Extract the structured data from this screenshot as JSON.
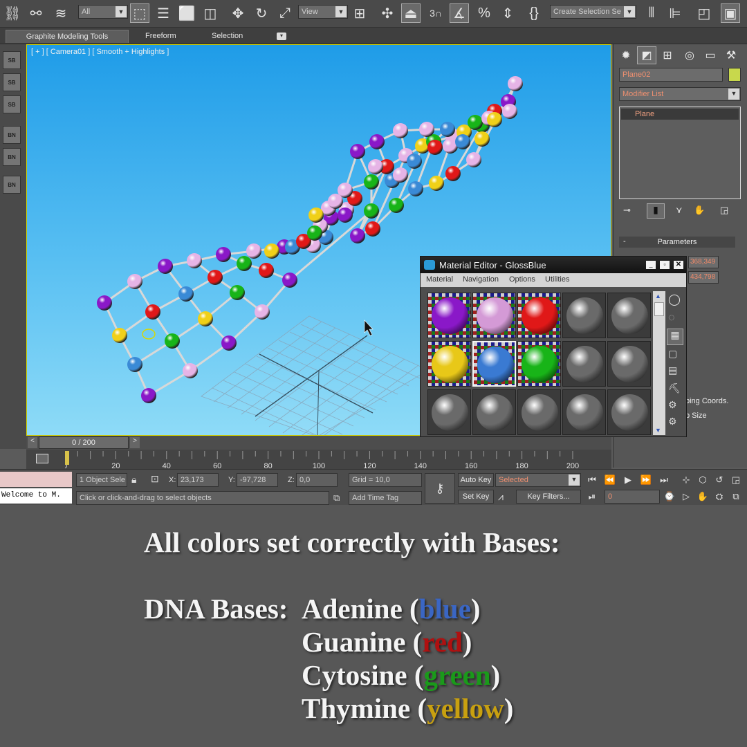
{
  "toolbar": {
    "selection_filter": "All",
    "ref_coord": "View",
    "snap_label": "3",
    "selection_set_placeholder": "Create Selection Se",
    "icons": [
      "link-icon",
      "unlink-icon",
      "bind-space-warp-icon",
      "select-object-icon",
      "select-by-name-icon",
      "rect-region-icon",
      "window-crossing-icon",
      "move-icon",
      "rotate-icon",
      "scale-icon",
      "pivot-icon",
      "mirror-icon",
      "align-icon",
      "layer-icon",
      "render-setup-icon"
    ]
  },
  "ribbon": {
    "tabs": [
      "Graphite Modeling Tools",
      "Freeform",
      "Selection"
    ]
  },
  "viewport": {
    "label": "[ + ] [ Camera01 ] [ Smooth + Highlights ]"
  },
  "timeline": {
    "frame": "0 / 200",
    "ticks": [
      "0",
      "20",
      "40",
      "60",
      "80",
      "100",
      "120",
      "140",
      "160",
      "180",
      "200"
    ]
  },
  "command_panel": {
    "object_name": "Plane02",
    "modifier_list": "Modifier List",
    "stack_item": "Plane",
    "rollout": "Parameters",
    "length_value": "368,349",
    "width_value": "434,798",
    "mapping_label": "ping Coords.",
    "map_size_label": "p Size",
    "object_color": "#c8d84c"
  },
  "material_editor": {
    "title": "Material Editor - GlossBlue",
    "menu": [
      "Material",
      "Navigation",
      "Options",
      "Utilities"
    ],
    "slots": [
      {
        "color": "#8a18c8",
        "active": true
      },
      {
        "color": "#d49ad6",
        "active": true
      },
      {
        "color": "#e01818",
        "active": true
      },
      {
        "color": "#6a6a6a",
        "active": false
      },
      {
        "color": "#6a6a6a",
        "active": false
      },
      {
        "color": "#e8c818",
        "active": true
      },
      {
        "color": "#3a7ad2",
        "active": true
      },
      {
        "color": "#18b418",
        "active": true
      },
      {
        "color": "#6a6a6a",
        "active": false
      },
      {
        "color": "#6a6a6a",
        "active": false
      },
      {
        "color": "#6a6a6a",
        "active": false
      },
      {
        "color": "#6a6a6a",
        "active": false
      },
      {
        "color": "#6a6a6a",
        "active": false
      },
      {
        "color": "#6a6a6a",
        "active": false
      },
      {
        "color": "#6a6a6a",
        "active": false
      }
    ]
  },
  "status": {
    "listener": "Welcome to M.",
    "selection_info": "1 Object Sele",
    "x_label": "X:",
    "x_value": "23,173",
    "y_label": "Y:",
    "y_value": "-97,728",
    "z_label": "Z:",
    "z_value": "0,0",
    "grid": "Grid = 10,0",
    "prompt": "Click or click-and-drag to select objects",
    "add_time_tag": "Add Time Tag",
    "auto_key": "Auto Key",
    "set_key": "Set Key",
    "key_filter_select": "Selected",
    "key_filters": "Key Filters...",
    "frame_field": "0"
  },
  "caption": {
    "line1": "All colors set correctly with Bases:",
    "dna_prefix": "DNA Bases:",
    "bases": [
      {
        "name": "Adenine (",
        "color_word": "blue",
        "close": ")",
        "color": "#3a66c4"
      },
      {
        "name": "Guanine (",
        "color_word": "red",
        "close": ")",
        "color": "#b01010"
      },
      {
        "name": "Cytosine (",
        "color_word": "green",
        "close": ")",
        "color": "#1a9a1a"
      },
      {
        "name": "Thymine (",
        "color_word": "yellow",
        "close": ")",
        "color": "#c8a010"
      }
    ]
  }
}
